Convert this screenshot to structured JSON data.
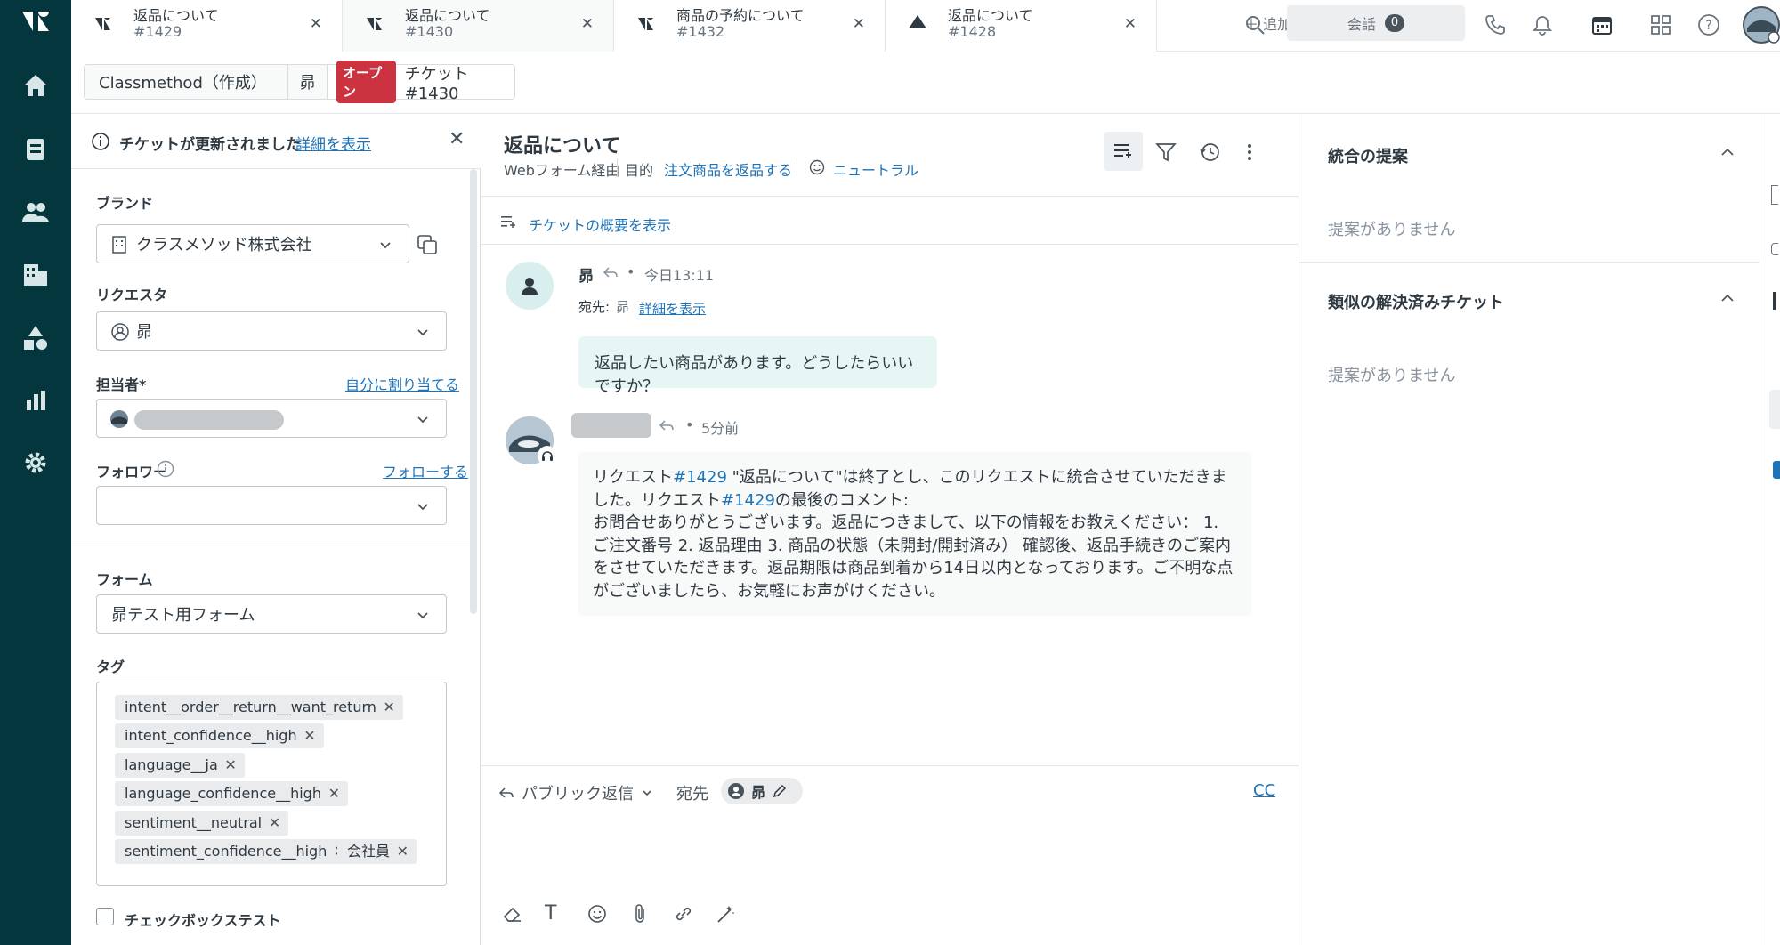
{
  "tabs": [
    {
      "title": "返品について",
      "number": "#1429",
      "icon": "ticket-icon"
    },
    {
      "title": "返品について",
      "number": "#1430",
      "icon": "ticket-icon"
    },
    {
      "title": "商品の予約について",
      "number": "#1432",
      "icon": "ticket-icon"
    },
    {
      "title": "返品について",
      "number": "#1428",
      "icon": "triangle-user-icon"
    }
  ],
  "topbar": {
    "add_label": "追加",
    "conversations_label": "会話",
    "conversations_count": "0"
  },
  "breadcrumb": {
    "org": "Classmethod（作成）",
    "user": "昴",
    "status": "オープン",
    "ticket": "チケット #1430"
  },
  "notice": {
    "text": "チケットが更新されました",
    "link": "詳細を表示"
  },
  "fields": {
    "brand_label": "ブランド",
    "brand_value": "クラスメソッド株式会社",
    "requester_label": "リクエスタ",
    "requester_value": "昴",
    "assignee_label": "担当者*",
    "assign_self": "自分に割り当てる",
    "follower_label": "フォロワー",
    "follow_link": "フォローする",
    "form_label": "フォーム",
    "form_value": "昴テスト用フォーム",
    "tags_label": "タグ",
    "tags": [
      "intent__order__return__want_return",
      "intent_confidence__high",
      "language__ja",
      "language_confidence__high",
      "sentiment__neutral",
      "sentiment_confidence__high",
      "会社員"
    ],
    "checkbox_label": "チェックボックステスト"
  },
  "ticket": {
    "subject": "返品について",
    "via": "Webフォーム経由",
    "purpose_label": "目的",
    "purpose_value": "注文商品を返品する",
    "sentiment": "ニュートラル",
    "summary_link": "チケットの概要を表示"
  },
  "messages": [
    {
      "author": "昴",
      "time": "今日13:11",
      "to_label": "宛先:",
      "to_value": "昴",
      "detail_link": "詳細を表示",
      "body": "返品したい商品があります。どうしたらいいですか？"
    },
    {
      "author": "",
      "time": "5分前",
      "body_prefix": "リクエスト",
      "body_link1": "#1429",
      "body_mid1": " \"返品について\"は終了とし、このリクエストに統合させていただきました。リクエスト",
      "body_link2": "#1429",
      "body_mid2": "の最後のコメント:",
      "body_rest": "お問合せありがとうございます。返品につきまして、以下の情報をお教えください： 1. ご注文番号 2. 返品理由 3. 商品の状態（未開封/開封済み） 確認後、返品手続きのご案内をさせていただきます。返品期限は商品到着から14日以内となっております。ご不明な点がございましたら、お気軽にお声がけください。"
    }
  ],
  "reply": {
    "type": "パブリック返信",
    "to_label": "宛先",
    "to_value": "昴",
    "cc": "CC"
  },
  "right": {
    "merge_title": "統合の提案",
    "merge_empty": "提案がありません",
    "similar_title": "類似の解決済みチケット",
    "similar_empty": "提案がありません"
  },
  "colors": {
    "rail": "#03363d",
    "link": "#1f73b7",
    "open_badge": "#cc3340",
    "request_bubble": "#e6f6f5"
  }
}
